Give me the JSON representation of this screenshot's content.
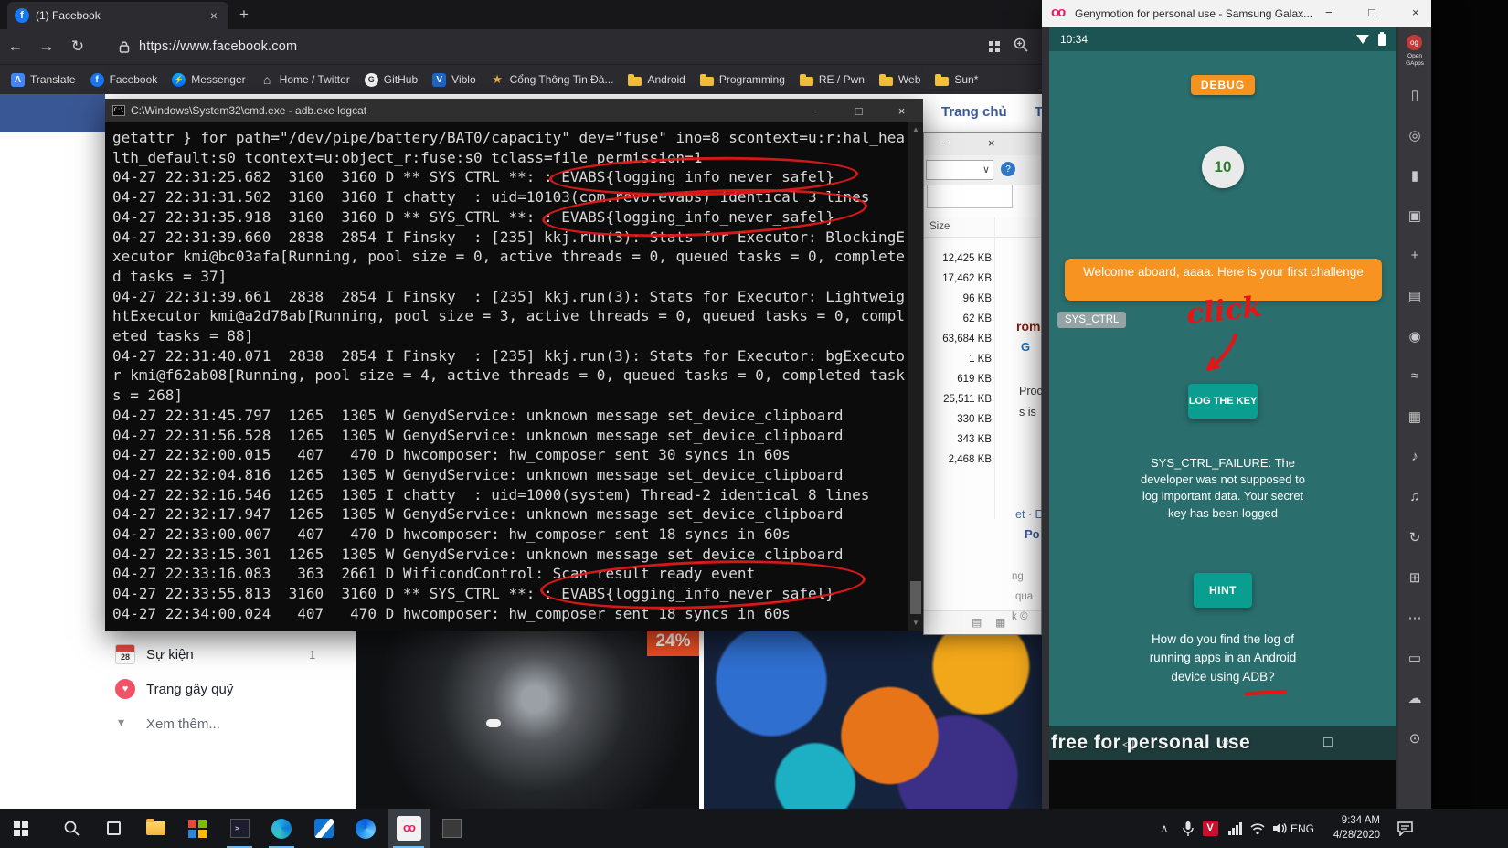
{
  "browser": {
    "tab_title": "(1) Facebook",
    "url": "https://www.facebook.com",
    "bookmarks": [
      {
        "icon": "translate",
        "label": "Translate"
      },
      {
        "icon": "facebook",
        "label": "Facebook"
      },
      {
        "icon": "messenger",
        "label": "Messenger"
      },
      {
        "icon": "twitter",
        "label": "Home / Twitter"
      },
      {
        "icon": "github",
        "label": "GitHub"
      },
      {
        "icon": "viblo",
        "label": "Viblo"
      },
      {
        "icon": "portal",
        "label": "Cổng Thông Tin Đà..."
      },
      {
        "icon": "folder",
        "label": "Android"
      },
      {
        "icon": "folder",
        "label": "Programming"
      },
      {
        "icon": "folder",
        "label": "RE / Pwn"
      },
      {
        "icon": "folder",
        "label": "Web"
      },
      {
        "icon": "folder",
        "label": "Sun*"
      }
    ]
  },
  "facebook": {
    "nav_items": [
      "Trang chủ",
      "T"
    ],
    "sidebar_items": [
      {
        "icon": "event-calendar",
        "icon_text": "28",
        "label": "Sự kiện",
        "badge": "1"
      },
      {
        "icon": "fundraiser-heart",
        "icon_text": "",
        "label": "Trang gây quỹ",
        "badge": ""
      },
      {
        "icon": "chevron-down",
        "icon_text": "",
        "label": "Xem thêm...",
        "badge": ""
      }
    ],
    "discount_badge": "24%"
  },
  "cmd": {
    "title": "C:\\Windows\\System32\\cmd.exe - adb.exe logcat",
    "lines": [
      "getattr } for path=\"/dev/pipe/battery/BAT0/capacity\" dev=\"fuse\" ino=8 scontext=u:r:hal_hea",
      "lth_default:s0 tcontext=u:object_r:fuse:s0 tclass=file permission=1",
      "04-27 22:31:25.682  3160  3160 D ** SYS_CTRL **: : EVABS{logging_info_never_safel}",
      "04-27 22:31:31.502  3160  3160 I chatty  : uid=10103(com.revo.evabs) identical 3 lines",
      "04-27 22:31:35.918  3160  3160 D ** SYS_CTRL **: : EVABS{logging_info_never_safel}",
      "04-27 22:31:39.660  2838  2854 I Finsky  : [235] kkj.run(3): Stats for Executor: BlockingE",
      "xecutor kmi@bc03afa[Running, pool size = 0, active threads = 0, queued tasks = 0, complete",
      "d tasks = 37]",
      "04-27 22:31:39.661  2838  2854 I Finsky  : [235] kkj.run(3): Stats for Executor: Lightweig",
      "htExecutor kmi@a2d78ab[Running, pool size = 3, active threads = 0, queued tasks = 0, compl",
      "eted tasks = 88]",
      "04-27 22:31:40.071  2838  2854 I Finsky  : [235] kkj.run(3): Stats for Executor: bgExecuto",
      "r kmi@f62ab08[Running, pool size = 4, active threads = 0, queued tasks = 0, completed task",
      "s = 268]",
      "04-27 22:31:45.797  1265  1305 W GenydService: unknown message set_device_clipboard",
      "04-27 22:31:56.528  1265  1305 W GenydService: unknown message set_device_clipboard",
      "04-27 22:32:00.015   407   470 D hwcomposer: hw_composer sent 30 syncs in 60s",
      "04-27 22:32:04.816  1265  1305 W GenydService: unknown message set_device_clipboard",
      "04-27 22:32:16.546  1265  1305 I chatty  : uid=1000(system) Thread-2 identical 8 lines",
      "04-27 22:32:17.947  1265  1305 W GenydService: unknown message set_device_clipboard",
      "04-27 22:33:00.007   407   470 D hwcomposer: hw_composer sent 18 syncs in 60s",
      "04-27 22:33:15.301  1265  1305 W GenydService: unknown message set_device_clipboard",
      "04-27 22:33:16.083   363  2661 D WificondControl: Scan result ready event",
      "04-27 22:33:55.813  3160  3160 D ** SYS_CTRL **: : EVABS{logging_info_never_safel}",
      "04-27 22:34:00.024   407   470 D hwcomposer: hw_composer sent 18 syncs in 60s"
    ]
  },
  "file_panel": {
    "size_header": "Size",
    "sizes": [
      "12,425 KB",
      "17,462 KB",
      "96 KB",
      "62 KB",
      "63,684 KB",
      "1 KB",
      "619 KB",
      "25,511 KB",
      "330 KB",
      "343 KB",
      "2,468 KB"
    ],
    "fragments": [
      "rom",
      "G",
      "Proc",
      "s is",
      "et · E",
      "Po",
      "ng",
      "qua",
      "k ©"
    ]
  },
  "genymotion": {
    "window_title": "Genymotion for personal use - Samsung Galax...",
    "status_time": "10:34",
    "debug_button": "DEBUG",
    "avatar_text": "10",
    "welcome_banner": "Welcome aboard, aaaa. Here is your first challenge",
    "sys_ctrl_chip": "SYS_CTRL",
    "click_note": "click",
    "log_key_button": "LOG THE KEY",
    "failure_text": "SYS_CTRL_FAILURE: The developer was not supposed to log important data. Your secret key has been logged",
    "hint_button": "HINT",
    "question_text": "How do you find the log of running apps in an Android device using ADB?",
    "watermark": "free for personal use",
    "opengapps_label": "Open GApps",
    "toolbar_icons": [
      "device",
      "gps",
      "battery",
      "screencast",
      "move",
      "identifiers",
      "camera",
      "network",
      "gallery",
      "volume-up",
      "volume-down",
      "rotate",
      "resize",
      "more",
      "dialer",
      "cloud",
      "power"
    ]
  },
  "taskbar": {
    "language": "ENG",
    "time": "9:34 AM",
    "date": "4/28/2020",
    "unikey": "V"
  },
  "colors": {
    "facebook_blue": "#3a5795",
    "edge_dark": "#2b2b30",
    "cmd_background": "#0c0c0c",
    "annotation_red": "#e61414",
    "genymotion_teal": "#2a6e6e",
    "accent_orange": "#f6921e",
    "button_teal": "#0a9e90",
    "discount_orange": "#f04f23",
    "taskbar": "#14161a"
  }
}
